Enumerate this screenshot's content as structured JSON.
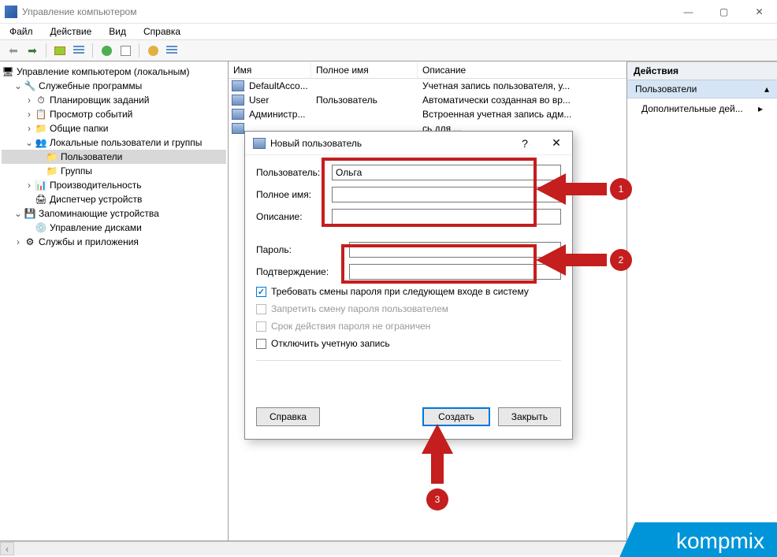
{
  "window": {
    "title": "Управление компьютером"
  },
  "menu": {
    "file": "Файл",
    "action": "Действие",
    "view": "Вид",
    "help": "Справка"
  },
  "tree": {
    "root": "Управление компьютером (локальным)",
    "items": [
      {
        "label": "Служебные программы",
        "expanded": true
      },
      {
        "label": "Планировщик заданий"
      },
      {
        "label": "Просмотр событий"
      },
      {
        "label": "Общие папки"
      },
      {
        "label": "Локальные пользователи и группы",
        "expanded": true
      },
      {
        "label": "Пользователи",
        "selected": true
      },
      {
        "label": "Группы"
      },
      {
        "label": "Производительность"
      },
      {
        "label": "Диспетчер устройств"
      },
      {
        "label": "Запоминающие устройства",
        "expanded": true
      },
      {
        "label": "Управление дисками"
      },
      {
        "label": "Службы и приложения"
      }
    ]
  },
  "list": {
    "columns": {
      "name": "Имя",
      "fullname": "Полное имя",
      "desc": "Описание"
    },
    "rows": [
      {
        "name": "DefaultAcco...",
        "full": "",
        "desc": "Учетная запись пользователя, у..."
      },
      {
        "name": "User",
        "full": "Пользователь",
        "desc": "Автоматически созданная во вр..."
      },
      {
        "name": "Администр...",
        "full": "",
        "desc": "Встроенная учетная запись адм..."
      },
      {
        "name": "",
        "full": "",
        "desc": "сь для ..."
      }
    ]
  },
  "actions": {
    "header": "Действия",
    "section": "Пользователи",
    "more": "Дополнительные дей..."
  },
  "dialog": {
    "title": "Новый пользователь",
    "labels": {
      "user": "Пользователь:",
      "full": "Полное имя:",
      "desc": "Описание:",
      "pass": "Пароль:",
      "confirm": "Подтверждение:"
    },
    "values": {
      "user": "Ольга",
      "full": "",
      "desc": "",
      "pass": "",
      "confirm": ""
    },
    "checks": {
      "must_change": "Требовать смены пароля при следующем входе в систему",
      "no_change": "Запретить смену пароля пользователем",
      "no_expire": "Срок действия пароля не ограничен",
      "disabled": "Отключить учетную запись"
    },
    "buttons": {
      "help": "Справка",
      "create": "Создать",
      "close": "Закрыть"
    }
  },
  "annotations": {
    "n1": "1",
    "n2": "2",
    "n3": "3"
  },
  "watermark": "kompmix"
}
